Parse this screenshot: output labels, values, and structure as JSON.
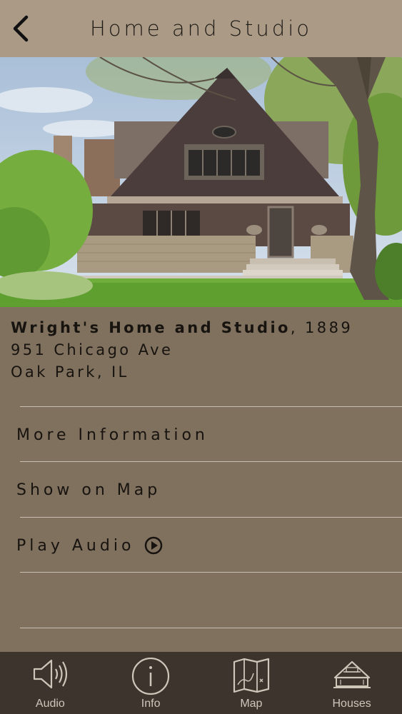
{
  "header": {
    "title": "Home and Studio"
  },
  "house": {
    "name": "Wright's Home and Studio",
    "year_text": ", 1889",
    "address_line1": "951 Chicago Ave",
    "address_line2": "Oak Park, IL"
  },
  "menu": [
    {
      "label": "More Information"
    },
    {
      "label": "Show on Map"
    },
    {
      "label": "Play Audio",
      "icon": "play-circle-icon"
    }
  ],
  "tabs": [
    {
      "label": "Audio",
      "icon": "speaker-icon"
    },
    {
      "label": "Info",
      "icon": "info-icon"
    },
    {
      "label": "Map",
      "icon": "map-icon"
    },
    {
      "label": "Houses",
      "icon": "house-icon"
    }
  ],
  "colors": {
    "navbar": "#ab9b86",
    "background": "#80715f",
    "tabbar": "#3d342e",
    "text": "#17130f",
    "divider": "#c9bfb2"
  }
}
